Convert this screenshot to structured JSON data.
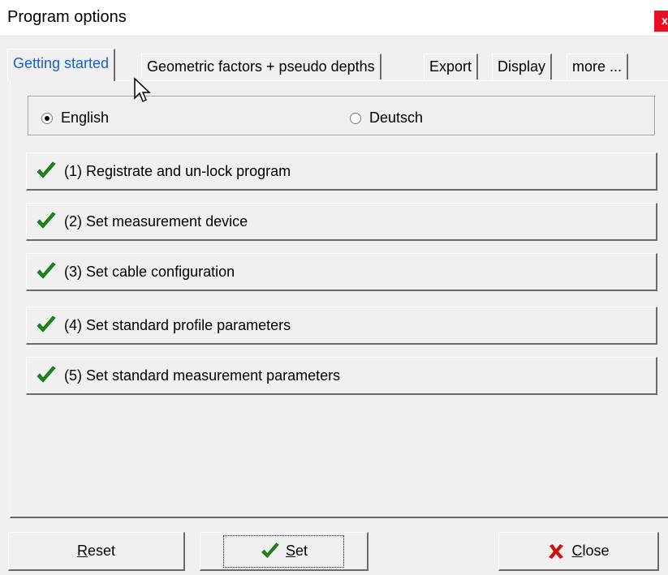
{
  "window": {
    "title": "Program options",
    "close_glyph": "x"
  },
  "tabs": [
    {
      "label": "Getting started",
      "active": true
    },
    {
      "label": "Geometric factors + pseudo depths",
      "active": false
    },
    {
      "label": "Export",
      "active": false
    },
    {
      "label": "Display",
      "active": false
    },
    {
      "label": "more ...",
      "active": false
    }
  ],
  "language": {
    "options": [
      {
        "label": "English",
        "selected": true
      },
      {
        "label": "Deutsch",
        "selected": false
      }
    ]
  },
  "steps": [
    {
      "label": "(1) Registrate and un-lock program",
      "icon": "check-icon"
    },
    {
      "label": "(2) Set measurement device",
      "icon": "check-icon"
    },
    {
      "label": "(3) Set cable configuration",
      "icon": "check-icon"
    },
    {
      "label": "(4) Set standard profile parameters",
      "icon": "check-icon"
    },
    {
      "label": "(5) Set standard measurement parameters",
      "icon": "check-icon"
    }
  ],
  "footer": {
    "reset": {
      "mnemonic": "R",
      "rest": "eset"
    },
    "set": {
      "mnemonic": "S",
      "rest": "et",
      "icon": "check-icon"
    },
    "close": {
      "mnemonic": "C",
      "rest": "lose",
      "icon": "x-mark-icon"
    }
  },
  "colors": {
    "check": "#1b8a1b",
    "close_x": "#cc1111",
    "active_tab_text": "#1a5fc9",
    "titlebar_close": "#e81123"
  }
}
